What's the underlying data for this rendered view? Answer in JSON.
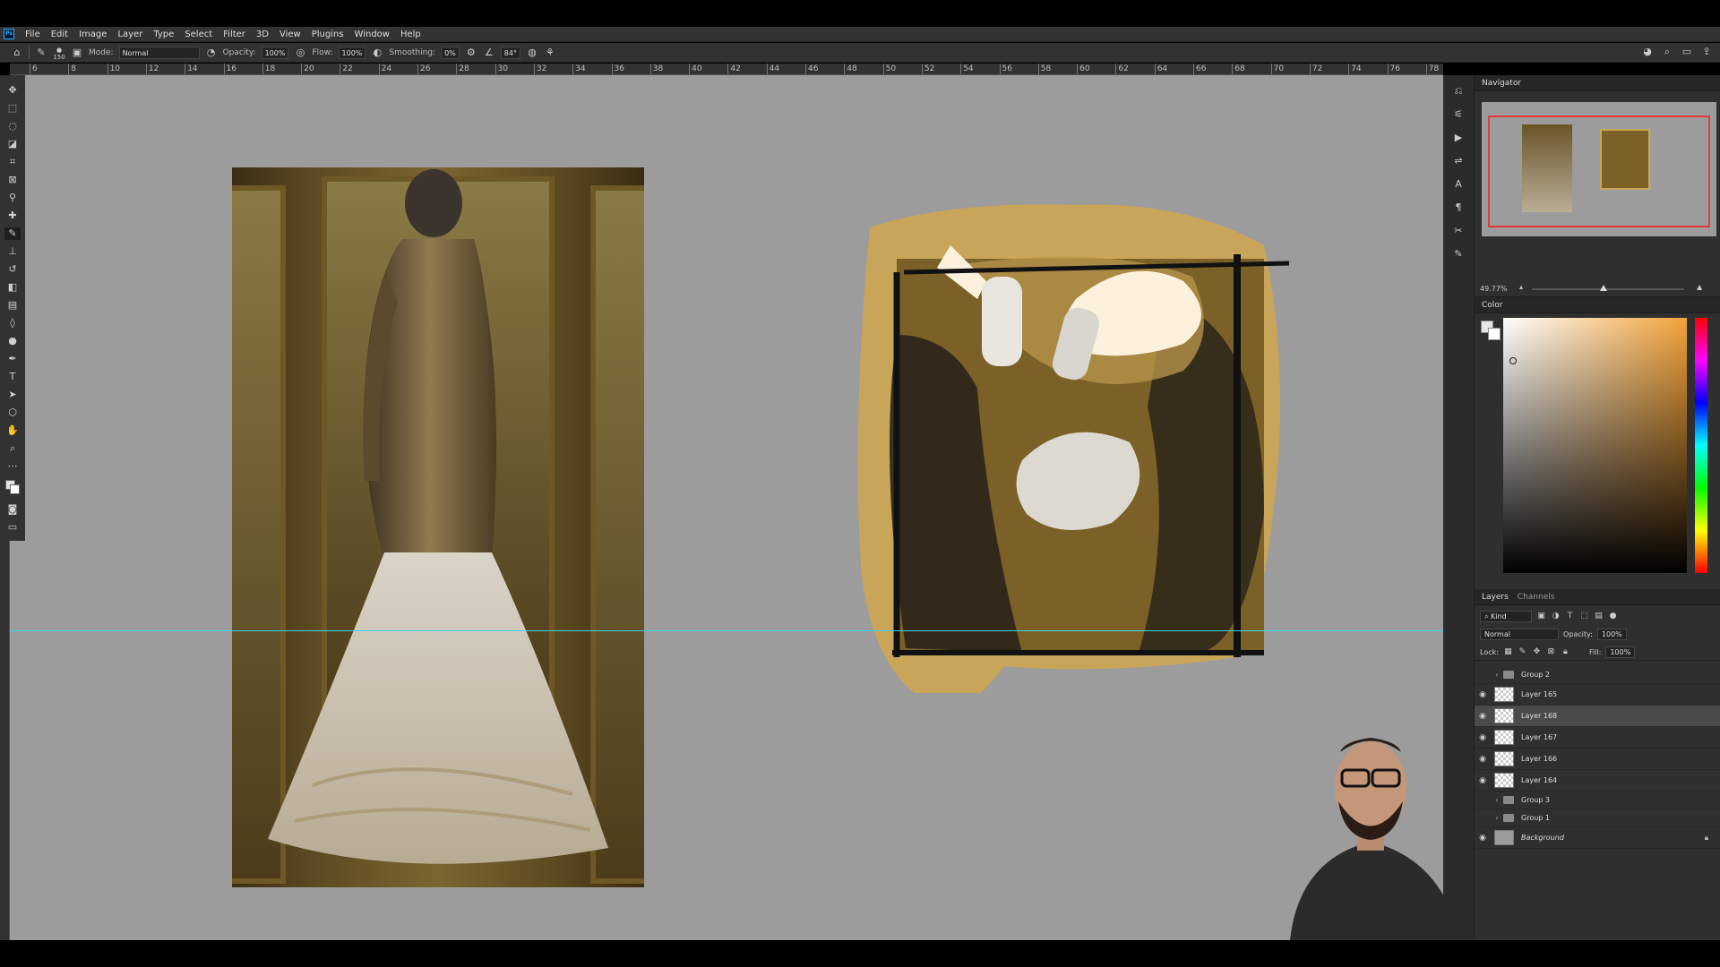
{
  "app": {
    "logo": "Ps"
  },
  "menubar": {
    "items": [
      "File",
      "Edit",
      "Image",
      "Layer",
      "Type",
      "Select",
      "Filter",
      "3D",
      "View",
      "Plugins",
      "Window",
      "Help"
    ]
  },
  "options_bar": {
    "brush_size": "150",
    "mode_label": "Mode:",
    "mode_value": "Normal",
    "opacity_label": "Opacity:",
    "opacity_value": "100%",
    "flow_label": "Flow:",
    "flow_value": "100%",
    "smoothing_label": "Smoothing:",
    "smoothing_value": "0%",
    "angle_value": "84°"
  },
  "ruler": {
    "labels": [
      "6",
      "8",
      "10",
      "12",
      "14",
      "16",
      "18",
      "20",
      "22",
      "24",
      "26",
      "28",
      "30",
      "32",
      "34",
      "36",
      "38",
      "40",
      "42",
      "44",
      "46",
      "48",
      "50",
      "52",
      "54",
      "56",
      "58",
      "60",
      "62",
      "64",
      "66",
      "68",
      "70",
      "72",
      "74",
      "76",
      "78"
    ]
  },
  "tools": [
    "move",
    "marquee",
    "lasso",
    "object-select",
    "crop",
    "frame",
    "eyedropper",
    "healing",
    "brush",
    "stamp",
    "history-brush",
    "eraser",
    "gradient",
    "blur",
    "dodge",
    "pen",
    "type",
    "path-select",
    "shape",
    "hand",
    "zoom",
    "more"
  ],
  "navigator": {
    "title": "Navigator",
    "zoom": "49.77%"
  },
  "color_panel": {
    "title": "Color",
    "foreground": "#e6e6e6",
    "background": "#ffffff",
    "hue_color": "#f3a33a"
  },
  "layers_panel": {
    "tabs": [
      "Layers",
      "Channels"
    ],
    "filter_label": "Kind",
    "blend_mode": "Normal",
    "opacity_label": "Opacity:",
    "opacity_value": "100%",
    "lock_label": "Lock:",
    "fill_label": "Fill:",
    "fill_value": "100%",
    "layers": [
      {
        "name": "Group 2",
        "type": "group",
        "visible": false
      },
      {
        "name": "Layer 165",
        "type": "layer",
        "visible": true
      },
      {
        "name": "Layer 168",
        "type": "layer",
        "visible": true,
        "selected": true
      },
      {
        "name": "Layer 167",
        "type": "layer",
        "visible": true
      },
      {
        "name": "Layer 166",
        "type": "layer",
        "visible": true
      },
      {
        "name": "Layer 164",
        "type": "layer",
        "visible": true
      },
      {
        "name": "Group 3",
        "type": "group",
        "visible": false
      },
      {
        "name": "Group 1",
        "type": "group",
        "visible": false
      },
      {
        "name": "Background",
        "type": "background",
        "visible": true,
        "locked": true
      }
    ]
  },
  "colors": {
    "canvas_bg": "#9c9c9c",
    "guide": "#35d6e6",
    "sketch_gold": "#c9a55a",
    "sketch_dark": "#2a2418"
  }
}
